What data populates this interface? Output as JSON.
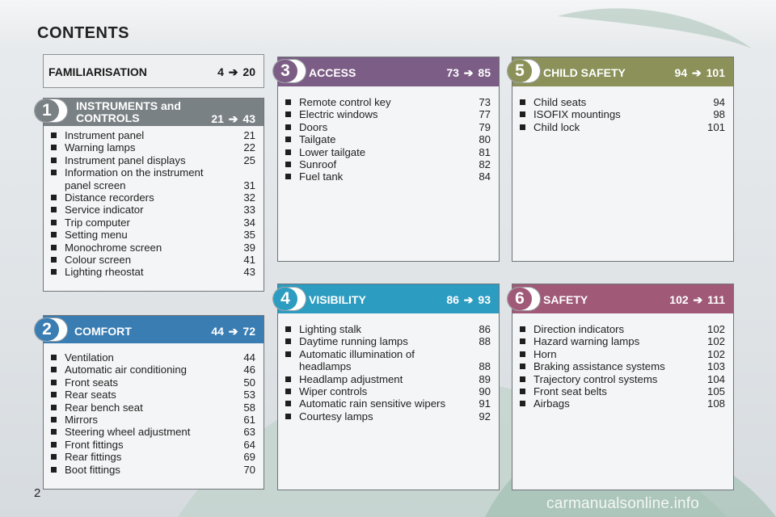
{
  "page": {
    "title": "CONTENTS",
    "number": "2",
    "watermark": "carmanualsonline.info",
    "arrow_glyph": "➔"
  },
  "familiarisation": {
    "label": "FAMILIARISATION",
    "from": "4",
    "to": "20"
  },
  "sections": [
    {
      "num": "1",
      "title_line1": "INSTRUMENTS and",
      "title_line2": "CONTROLS",
      "from": "21",
      "to": "43",
      "color": "#7a8185",
      "items": [
        {
          "text": "Instrument panel",
          "page": "21"
        },
        {
          "text": "Warning lamps",
          "page": "22"
        },
        {
          "text": "Instrument panel displays",
          "page": "25"
        },
        {
          "text": "Information on the instrument panel screen",
          "page": "31"
        },
        {
          "text": "Distance recorders",
          "page": "32"
        },
        {
          "text": "Service indicator",
          "page": "33"
        },
        {
          "text": "Trip computer",
          "page": "34"
        },
        {
          "text": "Setting menu",
          "page": "35"
        },
        {
          "text": "Monochrome screen",
          "page": "39"
        },
        {
          "text": "Colour screen",
          "page": "41"
        },
        {
          "text": "Lighting rheostat",
          "page": "43"
        }
      ]
    },
    {
      "num": "2",
      "title_line1": "COMFORT",
      "from": "44",
      "to": "72",
      "color": "#3a7db3",
      "items": [
        {
          "text": "Ventilation",
          "page": "44"
        },
        {
          "text": "Automatic air conditioning",
          "page": "46"
        },
        {
          "text": "Front seats",
          "page": "50"
        },
        {
          "text": "Rear seats",
          "page": "53"
        },
        {
          "text": "Rear bench seat",
          "page": "58"
        },
        {
          "text": "Mirrors",
          "page": "61"
        },
        {
          "text": "Steering wheel adjustment",
          "page": "63"
        },
        {
          "text": "Front fittings",
          "page": "64"
        },
        {
          "text": "Rear fittings",
          "page": "69"
        },
        {
          "text": "Boot fittings",
          "page": "70"
        }
      ]
    },
    {
      "num": "3",
      "title_line1": "ACCESS",
      "from": "73",
      "to": "85",
      "color": "#7c5d86",
      "items": [
        {
          "text": "Remote control key",
          "page": "73"
        },
        {
          "text": "Electric windows",
          "page": "77"
        },
        {
          "text": "Doors",
          "page": "79"
        },
        {
          "text": "Tailgate",
          "page": "80"
        },
        {
          "text": "Lower tailgate",
          "page": "81"
        },
        {
          "text": "Sunroof",
          "page": "82"
        },
        {
          "text": "Fuel tank",
          "page": "84"
        }
      ]
    },
    {
      "num": "4",
      "title_line1": "VISIBILITY",
      "from": "86",
      "to": "93",
      "color": "#2c9cc1",
      "items": [
        {
          "text": "Lighting stalk",
          "page": "86"
        },
        {
          "text": "Daytime running lamps",
          "page": "88"
        },
        {
          "text": "Automatic illumination of headlamps",
          "page": "88"
        },
        {
          "text": "Headlamp adjustment",
          "page": "89"
        },
        {
          "text": "Wiper controls",
          "page": "90"
        },
        {
          "text": "Automatic rain sensitive wipers",
          "page": "91"
        },
        {
          "text": "Courtesy lamps",
          "page": "92"
        }
      ]
    },
    {
      "num": "5",
      "title_line1": "CHILD SAFETY",
      "from": "94",
      "to": "101",
      "color": "#8b9158",
      "items": [
        {
          "text": "Child seats",
          "page": "94"
        },
        {
          "text": "ISOFIX mountings",
          "page": "98"
        },
        {
          "text": "Child lock",
          "page": "101"
        }
      ]
    },
    {
      "num": "6",
      "title_line1": "SAFETY",
      "from": "102",
      "to": "111",
      "color": "#a05a78",
      "items": [
        {
          "text": "Direction indicators",
          "page": "102"
        },
        {
          "text": "Hazard warning lamps",
          "page": "102"
        },
        {
          "text": "Horn",
          "page": "102"
        },
        {
          "text": "Braking assistance systems",
          "page": "103"
        },
        {
          "text": "Trajectory control systems",
          "page": "104"
        },
        {
          "text": "Front seat belts",
          "page": "105"
        },
        {
          "text": "Airbags",
          "page": "108"
        }
      ]
    }
  ]
}
